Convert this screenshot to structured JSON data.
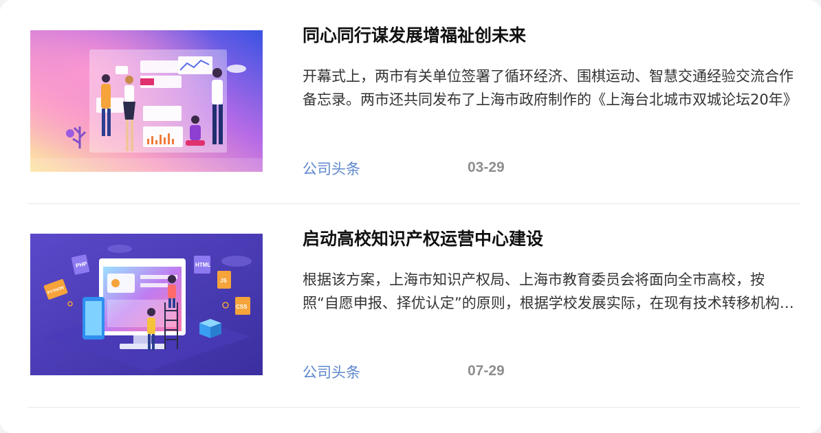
{
  "news": [
    {
      "title": "同心同行谋发展增福祉创未来",
      "summary": "开幕式上，两市有关单位签署了循环经济、围棋运动、智慧交通经验交流合作备忘录。两市还共同发布了上海市政府制作的《上海台北城市双城论坛20年》",
      "category": "公司头条",
      "date": "03-29",
      "image_alt": "business-team-illustration"
    },
    {
      "title": "启动高校知识产权运营中心建设",
      "summary": "根据该方案，上海市知识产权局、上海市教育委员会将面向全市高校，按照“自愿申报、择优认定”的原则，根据学校发展实际，在现有技术转移机构基础上",
      "category": "公司头条",
      "date": "07-29",
      "image_alt": "web-development-illustration",
      "image_labels": [
        "PHP",
        "HTML",
        "JS",
        "CSS",
        "PYTHON"
      ]
    }
  ],
  "colors": {
    "category": "#5b86cc",
    "date": "#8e8e8e",
    "title": "#111111"
  }
}
